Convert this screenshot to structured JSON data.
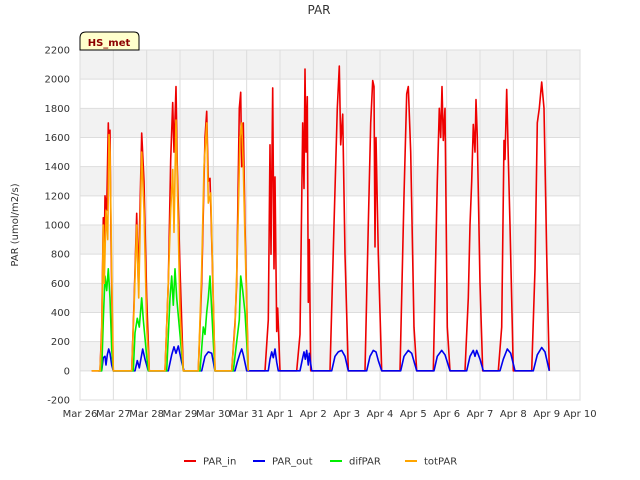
{
  "chart_data": {
    "type": "line",
    "title": "PAR",
    "badge": "HS_met",
    "ylabel": "PAR (umol/m2/s)",
    "xlabel": "",
    "ylim": [
      -200,
      2200
    ],
    "xlim": [
      0,
      15
    ],
    "yticks": [
      -200,
      0,
      200,
      400,
      600,
      800,
      1000,
      1200,
      1400,
      1600,
      1800,
      2000,
      2200
    ],
    "xticks": [
      {
        "x": 0,
        "label": "Mar 26"
      },
      {
        "x": 1,
        "label": "Mar 27"
      },
      {
        "x": 2,
        "label": "Mar 28"
      },
      {
        "x": 3,
        "label": "Mar 29"
      },
      {
        "x": 4,
        "label": "Mar 30"
      },
      {
        "x": 5,
        "label": "Mar 31"
      },
      {
        "x": 6,
        "label": "Apr 1"
      },
      {
        "x": 7,
        "label": "Apr 2"
      },
      {
        "x": 8,
        "label": "Apr 3"
      },
      {
        "x": 9,
        "label": "Apr 4"
      },
      {
        "x": 10,
        "label": "Apr 5"
      },
      {
        "x": 11,
        "label": "Apr 6"
      },
      {
        "x": 12,
        "label": "Apr 7"
      },
      {
        "x": 13,
        "label": "Apr 8"
      },
      {
        "x": 14,
        "label": "Apr 9"
      },
      {
        "x": 15,
        "label": "Apr 10"
      }
    ],
    "grid": true,
    "legend_position": "bottom",
    "series": [
      {
        "name": "PAR_in",
        "color": "#ee0000",
        "points": [
          [
            0.35,
            0
          ],
          [
            0.6,
            0
          ],
          [
            0.65,
            300
          ],
          [
            0.7,
            1050
          ],
          [
            0.72,
            700
          ],
          [
            0.75,
            1200
          ],
          [
            0.8,
            1100
          ],
          [
            0.85,
            1700
          ],
          [
            0.88,
            1400
          ],
          [
            0.9,
            1650
          ],
          [
            0.93,
            900
          ],
          [
            0.97,
            300
          ],
          [
            1.0,
            0
          ],
          [
            1.55,
            0
          ],
          [
            1.62,
            460
          ],
          [
            1.7,
            1080
          ],
          [
            1.75,
            600
          ],
          [
            1.85,
            1630
          ],
          [
            1.92,
            1300
          ],
          [
            2.0,
            500
          ],
          [
            2.08,
            0
          ],
          [
            2.55,
            0
          ],
          [
            2.65,
            600
          ],
          [
            2.72,
            1450
          ],
          [
            2.78,
            1840
          ],
          [
            2.82,
            1500
          ],
          [
            2.88,
            1950
          ],
          [
            2.92,
            1400
          ],
          [
            3.0,
            700
          ],
          [
            3.1,
            0
          ],
          [
            3.55,
            0
          ],
          [
            3.65,
            600
          ],
          [
            3.75,
            1600
          ],
          [
            3.8,
            1780
          ],
          [
            3.85,
            1300
          ],
          [
            3.9,
            1320
          ],
          [
            3.95,
            900
          ],
          [
            4.05,
            0
          ],
          [
            4.55,
            0
          ],
          [
            4.65,
            330
          ],
          [
            4.7,
            600
          ],
          [
            4.78,
            1800
          ],
          [
            4.82,
            1910
          ],
          [
            4.85,
            1400
          ],
          [
            4.9,
            1700
          ],
          [
            4.95,
            1000
          ],
          [
            5.05,
            0
          ],
          [
            5.55,
            0
          ],
          [
            5.65,
            350
          ],
          [
            5.7,
            1550
          ],
          [
            5.73,
            800
          ],
          [
            5.78,
            1940
          ],
          [
            5.82,
            700
          ],
          [
            5.85,
            1330
          ],
          [
            5.9,
            270
          ],
          [
            5.93,
            430
          ],
          [
            6.0,
            0
          ],
          [
            6.5,
            0
          ],
          [
            6.6,
            250
          ],
          [
            6.68,
            1700
          ],
          [
            6.72,
            1250
          ],
          [
            6.75,
            2070
          ],
          [
            6.78,
            1500
          ],
          [
            6.82,
            1880
          ],
          [
            6.85,
            470
          ],
          [
            6.88,
            900
          ],
          [
            6.92,
            0
          ],
          [
            7.5,
            0
          ],
          [
            7.62,
            1000
          ],
          [
            7.72,
            1800
          ],
          [
            7.78,
            2090
          ],
          [
            7.82,
            1550
          ],
          [
            7.88,
            1760
          ],
          [
            7.95,
            800
          ],
          [
            8.05,
            0
          ],
          [
            8.55,
            0
          ],
          [
            8.65,
            1000
          ],
          [
            8.72,
            1700
          ],
          [
            8.78,
            1990
          ],
          [
            8.82,
            1950
          ],
          [
            8.85,
            850
          ],
          [
            8.88,
            1600
          ],
          [
            8.95,
            800
          ],
          [
            9.05,
            0
          ],
          [
            9.6,
            0
          ],
          [
            9.72,
            1200
          ],
          [
            9.8,
            1900
          ],
          [
            9.85,
            1950
          ],
          [
            9.92,
            1500
          ],
          [
            10.02,
            300
          ],
          [
            10.1,
            0
          ],
          [
            10.6,
            0
          ],
          [
            10.72,
            1300
          ],
          [
            10.78,
            1800
          ],
          [
            10.82,
            1600
          ],
          [
            10.86,
            1950
          ],
          [
            10.9,
            1580
          ],
          [
            10.95,
            1800
          ],
          [
            11.02,
            300
          ],
          [
            11.1,
            0
          ],
          [
            11.55,
            0
          ],
          [
            11.65,
            500
          ],
          [
            11.7,
            1000
          ],
          [
            11.75,
            1300
          ],
          [
            11.8,
            1690
          ],
          [
            11.85,
            1500
          ],
          [
            11.88,
            1860
          ],
          [
            11.92,
            1600
          ],
          [
            12.0,
            600
          ],
          [
            12.08,
            0
          ],
          [
            12.55,
            0
          ],
          [
            12.65,
            300
          ],
          [
            12.72,
            1580
          ],
          [
            12.75,
            1450
          ],
          [
            12.8,
            1930
          ],
          [
            12.85,
            1460
          ],
          [
            12.9,
            1000
          ],
          [
            13.0,
            0
          ],
          [
            13.55,
            0
          ],
          [
            13.65,
            700
          ],
          [
            13.72,
            1700
          ],
          [
            13.78,
            1800
          ],
          [
            13.85,
            1980
          ],
          [
            13.92,
            1800
          ],
          [
            14.0,
            800
          ],
          [
            14.08,
            0
          ]
        ]
      },
      {
        "name": "PAR_out",
        "color": "#0000ee",
        "points": [
          [
            0.55,
            0
          ],
          [
            0.65,
            0
          ],
          [
            0.7,
            90
          ],
          [
            0.75,
            100
          ],
          [
            0.78,
            40
          ],
          [
            0.82,
            110
          ],
          [
            0.86,
            150
          ],
          [
            0.9,
            120
          ],
          [
            0.95,
            40
          ],
          [
            1.0,
            0
          ],
          [
            1.65,
            0
          ],
          [
            1.72,
            70
          ],
          [
            1.78,
            20
          ],
          [
            1.88,
            150
          ],
          [
            1.95,
            80
          ],
          [
            2.05,
            0
          ],
          [
            2.65,
            0
          ],
          [
            2.75,
            110
          ],
          [
            2.82,
            165
          ],
          [
            2.88,
            120
          ],
          [
            2.95,
            170
          ],
          [
            3.05,
            60
          ],
          [
            3.12,
            0
          ],
          [
            3.65,
            0
          ],
          [
            3.75,
            100
          ],
          [
            3.85,
            130
          ],
          [
            3.95,
            120
          ],
          [
            4.05,
            0
          ],
          [
            4.65,
            0
          ],
          [
            4.72,
            60
          ],
          [
            4.8,
            120
          ],
          [
            4.85,
            150
          ],
          [
            4.9,
            110
          ],
          [
            5.0,
            0
          ],
          [
            5.65,
            0
          ],
          [
            5.7,
            80
          ],
          [
            5.75,
            130
          ],
          [
            5.8,
            90
          ],
          [
            5.85,
            150
          ],
          [
            5.9,
            60
          ],
          [
            5.95,
            0
          ],
          [
            6.6,
            0
          ],
          [
            6.68,
            90
          ],
          [
            6.72,
            130
          ],
          [
            6.76,
            80
          ],
          [
            6.8,
            140
          ],
          [
            6.85,
            40
          ],
          [
            6.88,
            120
          ],
          [
            6.95,
            0
          ],
          [
            7.55,
            0
          ],
          [
            7.65,
            100
          ],
          [
            7.75,
            130
          ],
          [
            7.85,
            140
          ],
          [
            7.95,
            100
          ],
          [
            8.05,
            0
          ],
          [
            8.6,
            0
          ],
          [
            8.7,
            100
          ],
          [
            8.8,
            140
          ],
          [
            8.88,
            130
          ],
          [
            8.95,
            70
          ],
          [
            9.05,
            0
          ],
          [
            9.62,
            0
          ],
          [
            9.72,
            100
          ],
          [
            9.85,
            140
          ],
          [
            9.95,
            120
          ],
          [
            10.1,
            0
          ],
          [
            10.62,
            0
          ],
          [
            10.72,
            100
          ],
          [
            10.85,
            140
          ],
          [
            10.95,
            110
          ],
          [
            11.1,
            0
          ],
          [
            11.6,
            0
          ],
          [
            11.7,
            100
          ],
          [
            11.8,
            140
          ],
          [
            11.85,
            100
          ],
          [
            11.9,
            140
          ],
          [
            12.0,
            80
          ],
          [
            12.1,
            0
          ],
          [
            12.6,
            0
          ],
          [
            12.7,
            80
          ],
          [
            12.82,
            150
          ],
          [
            12.92,
            120
          ],
          [
            13.05,
            0
          ],
          [
            13.6,
            0
          ],
          [
            13.72,
            110
          ],
          [
            13.85,
            160
          ],
          [
            13.95,
            130
          ],
          [
            14.08,
            0
          ]
        ]
      },
      {
        "name": "difPAR",
        "color": "#00ee00",
        "points": [
          [
            0.55,
            0
          ],
          [
            0.65,
            0
          ],
          [
            0.7,
            350
          ],
          [
            0.75,
            650
          ],
          [
            0.8,
            550
          ],
          [
            0.85,
            700
          ],
          [
            0.9,
            500
          ],
          [
            0.95,
            150
          ],
          [
            1.0,
            0
          ],
          [
            1.6,
            0
          ],
          [
            1.65,
            260
          ],
          [
            1.72,
            360
          ],
          [
            1.78,
            300
          ],
          [
            1.85,
            500
          ],
          [
            1.9,
            350
          ],
          [
            2.0,
            100
          ],
          [
            2.05,
            0
          ],
          [
            2.6,
            0
          ],
          [
            2.7,
            500
          ],
          [
            2.75,
            650
          ],
          [
            2.8,
            450
          ],
          [
            2.85,
            700
          ],
          [
            2.9,
            500
          ],
          [
            3.0,
            250
          ],
          [
            3.1,
            0
          ],
          [
            3.6,
            0
          ],
          [
            3.7,
            300
          ],
          [
            3.75,
            250
          ],
          [
            3.8,
            400
          ],
          [
            3.85,
            500
          ],
          [
            3.9,
            650
          ],
          [
            4.0,
            200
          ],
          [
            4.05,
            0
          ],
          [
            4.6,
            0
          ],
          [
            4.7,
            200
          ],
          [
            4.78,
            350
          ],
          [
            4.82,
            650
          ],
          [
            4.88,
            550
          ],
          [
            4.95,
            400
          ],
          [
            5.0,
            200
          ],
          [
            5.05,
            0
          ]
        ]
      },
      {
        "name": "totPAR",
        "color": "#ffa500",
        "points": [
          [
            0.35,
            0
          ],
          [
            0.6,
            0
          ],
          [
            0.65,
            250
          ],
          [
            0.7,
            1000
          ],
          [
            0.73,
            600
          ],
          [
            0.78,
            1100
          ],
          [
            0.83,
            900
          ],
          [
            0.87,
            1620
          ],
          [
            0.9,
            1500
          ],
          [
            0.95,
            700
          ],
          [
            1.0,
            0
          ],
          [
            1.55,
            0
          ],
          [
            1.62,
            420
          ],
          [
            1.7,
            1000
          ],
          [
            1.76,
            500
          ],
          [
            1.85,
            1500
          ],
          [
            1.92,
            1100
          ],
          [
            2.0,
            300
          ],
          [
            2.08,
            0
          ],
          [
            2.55,
            0
          ],
          [
            2.65,
            600
          ],
          [
            2.72,
            1100
          ],
          [
            2.78,
            1380
          ],
          [
            2.82,
            950
          ],
          [
            2.88,
            1720
          ],
          [
            2.92,
            1300
          ],
          [
            3.0,
            400
          ],
          [
            3.1,
            0
          ],
          [
            3.55,
            0
          ],
          [
            3.65,
            700
          ],
          [
            3.72,
            1400
          ],
          [
            3.8,
            1700
          ],
          [
            3.85,
            1150
          ],
          [
            3.92,
            1220
          ],
          [
            4.0,
            500
          ],
          [
            4.05,
            0
          ],
          [
            4.55,
            0
          ],
          [
            4.65,
            300
          ],
          [
            4.72,
            800
          ],
          [
            4.8,
            1600
          ],
          [
            4.85,
            1700
          ],
          [
            4.9,
            1400
          ],
          [
            4.95,
            900
          ],
          [
            5.05,
            0
          ]
        ]
      }
    ]
  }
}
